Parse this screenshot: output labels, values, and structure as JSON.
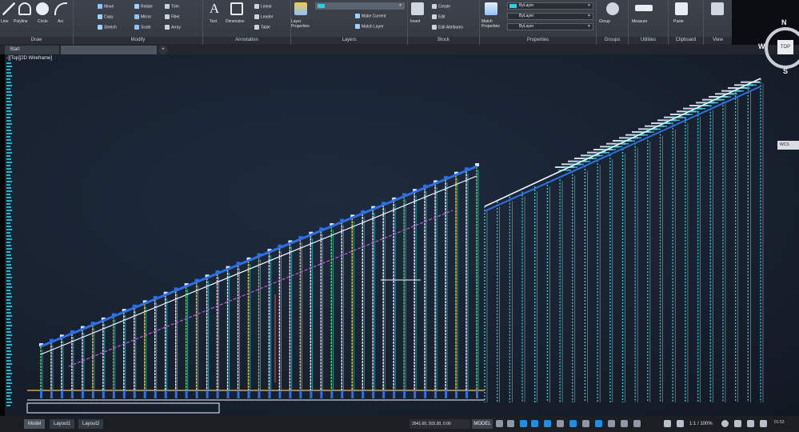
{
  "ribbon": {
    "draw": {
      "title": "Draw",
      "tools": [
        "Line",
        "Polyline",
        "Circle",
        "Arc"
      ]
    },
    "modify": {
      "title": "Modify",
      "tools": [
        "Move",
        "Rotate",
        "Trim",
        "Copy",
        "Mirror",
        "Fillet",
        "Stretch",
        "Scale",
        "Array"
      ]
    },
    "annotation": {
      "title": "Annotation",
      "tools": [
        "Text",
        "Dimension",
        "Linear",
        "Leader",
        "Table"
      ]
    },
    "layers": {
      "title": "Layers",
      "layer_properties": "Layer Properties",
      "make_current": "Make Current",
      "match_layer": "Match Layer"
    },
    "block": {
      "title": "Block",
      "tools": [
        "Insert",
        "Create",
        "Edit",
        "Edit Attributes"
      ]
    },
    "properties": {
      "title": "Properties",
      "match_properties": "Match Properties",
      "color_value": "ByLayer",
      "linetype_value": "ByLayer",
      "lineweight_value": "ByLayer"
    },
    "groups": {
      "title": "Groups",
      "tool": "Group"
    },
    "utilities": {
      "title": "Utilities",
      "tool": "Measure"
    },
    "clipboard": {
      "title": "Clipboard",
      "tool": "Paste"
    },
    "view": {
      "title": "View"
    }
  },
  "file_tabs": {
    "start": "Start",
    "add": "+"
  },
  "viewport": {
    "label": "-][Top][2D Wireframe]"
  },
  "viewcube": {
    "north": "N",
    "south": "S",
    "west": "W",
    "face": "TOP",
    "wcs": "WCS"
  },
  "statusbar": {
    "layout_tabs": [
      "Model",
      "Layout1",
      "Layout2"
    ],
    "coordinates": "2641.00, 915.30, 0.00",
    "model_button": "MODEL",
    "scale": "1:1 / 100%",
    "clock": "01:53"
  },
  "colors": {
    "ribbon_bg": "#3a4048",
    "viewport_bg": "#1b2533",
    "accent_cyan": "#1fd4e6",
    "line_blue": "#2f6fe6",
    "line_white": "#f2f6ff",
    "line_red": "#e84a4a"
  }
}
